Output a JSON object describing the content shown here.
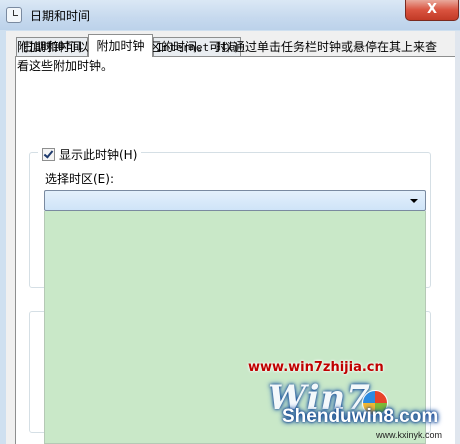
{
  "window": {
    "title": "日期和时间",
    "close_label": "X"
  },
  "tabs": [
    {
      "label": "日期和时间",
      "active": false
    },
    {
      "label": "附加时钟",
      "active": true
    },
    {
      "label": "Internet 时间",
      "active": false
    }
  ],
  "page": {
    "description": "附加时钟可以显示其他时区的时间。可以通过单击任务栏时钟或悬停在其上来查看这些附加时钟。",
    "clock1": {
      "show_label": "显示此时钟(H)",
      "checked": true,
      "timezone_label": "选择时区(E):",
      "timezone_value": ""
    }
  },
  "watermark": {
    "url": "www.win7zhijia.cn",
    "logo": "Win7",
    "site": "Shenduwin8.com",
    "small": "www.kxinyk.com"
  },
  "colors": {
    "dropdown_list": "#c9e8c8",
    "close_button": "#d9533f"
  }
}
